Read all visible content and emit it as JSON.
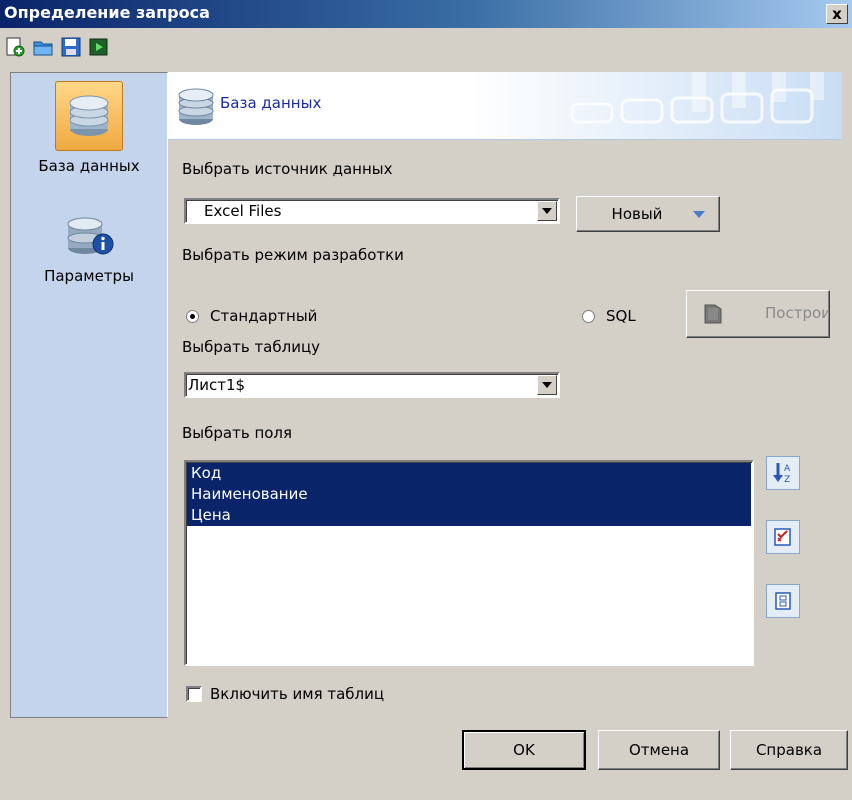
{
  "window": {
    "title": "Определение запроса",
    "close_label": "x"
  },
  "toolbar": {
    "buttons": [
      {
        "icon": "new-icon"
      },
      {
        "icon": "open-icon"
      },
      {
        "icon": "save-icon"
      },
      {
        "icon": "run-icon"
      }
    ]
  },
  "sidebar": {
    "items": [
      {
        "label": "База данных",
        "icon": "database-icon",
        "active": true
      },
      {
        "label": "Параметры",
        "icon": "database-info-icon",
        "active": false
      }
    ]
  },
  "banner": {
    "title": "База данных"
  },
  "form": {
    "source_label": "Выбрать источник данных",
    "source_value": "Excel Files",
    "new_button": "Новый",
    "mode_label": "Выбрать режим разработки",
    "mode_standard": "Стандартный",
    "mode_sql": "SQL",
    "selected_mode": "Стандартный",
    "build_button": "Построит",
    "table_label": "Выбрать таблицу",
    "table_value": "Лист1$",
    "fields_label": "Выбрать поля",
    "fields": [
      "Код",
      "Наименование",
      "Цена"
    ],
    "include_table_name": "Включить имя таблиц",
    "include_table_name_checked": false
  },
  "footer": {
    "ok": "OK",
    "cancel": "Отмена",
    "help": "Справка"
  },
  "colors": {
    "selection": "#0a246a",
    "sidebar_bg": "#c3d4ec",
    "active_item": "#f0a940",
    "banner_title": "#1a2aa0"
  }
}
